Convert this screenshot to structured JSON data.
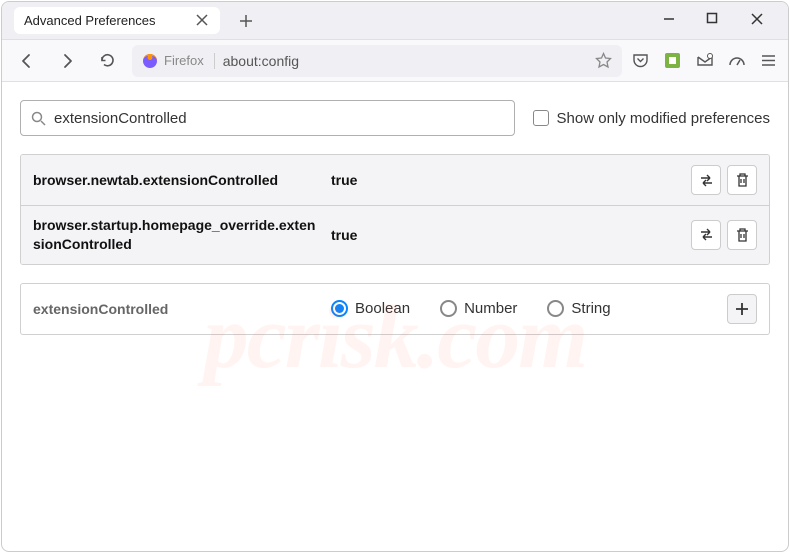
{
  "tab": {
    "title": "Advanced Preferences"
  },
  "urlbar": {
    "product": "Firefox",
    "url": "about:config"
  },
  "search": {
    "value": "extensionControlled"
  },
  "checkbox": {
    "label": "Show only modified preferences"
  },
  "prefs": [
    {
      "name": "browser.newtab.extensionControlled",
      "value": "true"
    },
    {
      "name": "browser.startup.homepage_override.extensionControlled",
      "value": "true"
    }
  ],
  "newPref": {
    "name": "extensionControlled",
    "types": [
      "Boolean",
      "Number",
      "String"
    ],
    "selected": 0
  },
  "watermark": "pcrisk.com"
}
